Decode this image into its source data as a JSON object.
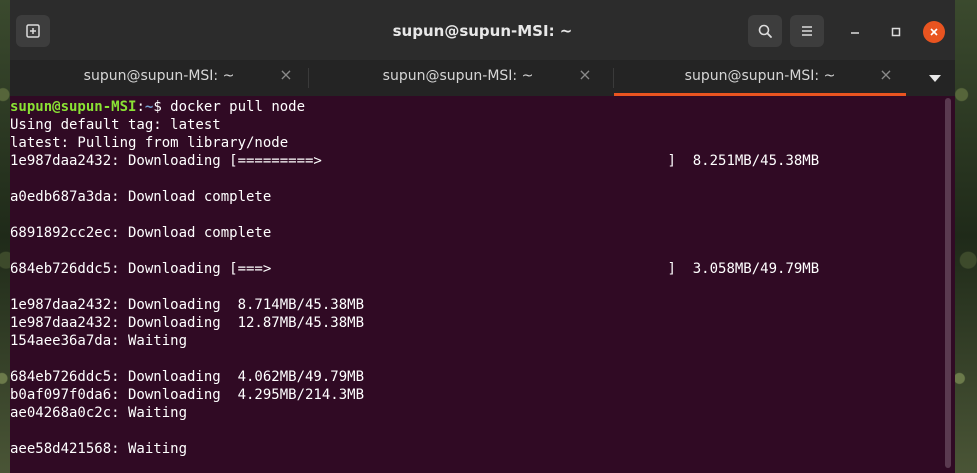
{
  "window": {
    "title": "supun@supun-MSI: ~"
  },
  "tabs": [
    {
      "label": "supun@supun-MSI: ~",
      "active": false
    },
    {
      "label": "supun@supun-MSI: ~",
      "active": false
    },
    {
      "label": "supun@supun-MSI: ~",
      "active": true
    }
  ],
  "tab_close_glyph": "×",
  "icons": {
    "new_tab": "new-tab-icon",
    "search": "search-icon",
    "menu": "hamburger-menu-icon",
    "minimize": "minimize-icon",
    "maximize": "maximize-icon",
    "close": "close-icon",
    "tab_list": "chevron-down-icon"
  },
  "colors": {
    "terminal_bg": "#300a24",
    "prompt_user": "#8ae234",
    "prompt_path": "#729fcf",
    "accent": "#e95420"
  },
  "terminal": {
    "prompt": {
      "user_host": "supun@supun-MSI",
      "sep": ":",
      "path": "~",
      "symbol": "$",
      "command": " docker pull node"
    },
    "lines": [
      "Using default tag: latest",
      "latest: Pulling from library/node",
      "1e987daa2432: Downloading [=========>                                         ]  8.251MB/45.38MB",
      "",
      "a0edb687a3da: Download complete",
      "",
      "6891892cc2ec: Download complete",
      "",
      "684eb726ddc5: Downloading [===>                                               ]  3.058MB/49.79MB",
      "",
      "1e987daa2432: Downloading  8.714MB/45.38MB",
      "1e987daa2432: Downloading  12.87MB/45.38MB",
      "154aee36a7da: Waiting",
      "",
      "684eb726ddc5: Downloading  4.062MB/49.79MB",
      "b0af097f0da6: Downloading  4.295MB/214.3MB",
      "ae04268a0c2c: Waiting",
      "",
      "aee58d421568: Waiting"
    ]
  }
}
